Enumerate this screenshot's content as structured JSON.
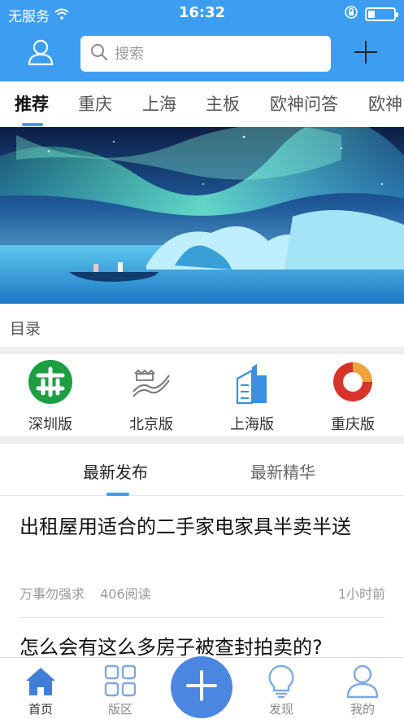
{
  "status_bar": {
    "carrier": "无服务",
    "time": "16:32",
    "battery_level": 0.25
  },
  "header": {
    "search_placeholder": "搜索",
    "icons": {
      "user": "user-icon",
      "search": "search-icon",
      "add": "plus-icon"
    }
  },
  "tabs": [
    {
      "label": "推荐",
      "active": true
    },
    {
      "label": "重庆"
    },
    {
      "label": "上海"
    },
    {
      "label": "主板"
    },
    {
      "label": "欧神问答"
    },
    {
      "label": "欧神"
    }
  ],
  "banner": {
    "icon": "aurora-banner-image"
  },
  "catalog": {
    "title": "目录"
  },
  "boards": [
    {
      "label": "深圳版",
      "icon": "shenzhen-metro-logo-icon"
    },
    {
      "label": "北京版",
      "icon": "great-wall-icon"
    },
    {
      "label": "上海版",
      "icon": "building-icon"
    },
    {
      "label": "重庆版",
      "icon": "chongqing-logo-icon"
    }
  ],
  "feed_tabs": [
    {
      "label": "最新发布",
      "active": true
    },
    {
      "label": "最新精华"
    }
  ],
  "posts": [
    {
      "title": "出租屋用适合的二手家电家具半卖半送",
      "author": "万事勿强求",
      "reads": "406阅读",
      "time": "1小时前"
    },
    {
      "title": "怎么会有这么多房子被查封拍卖的?"
    }
  ],
  "bottom_nav": [
    {
      "label": "首页",
      "icon": "home-icon",
      "active": true
    },
    {
      "label": "版区",
      "icon": "grid-icon"
    },
    {
      "label": "",
      "icon": "plus-icon"
    },
    {
      "label": "发现",
      "icon": "lightbulb-icon"
    },
    {
      "label": "我的",
      "icon": "user-icon"
    }
  ],
  "colors": {
    "primary": "#3d9ef1",
    "fab": "#4b86e0",
    "nav_active": "#3f7fd9",
    "nav_inactive": "#7fa8e6"
  }
}
